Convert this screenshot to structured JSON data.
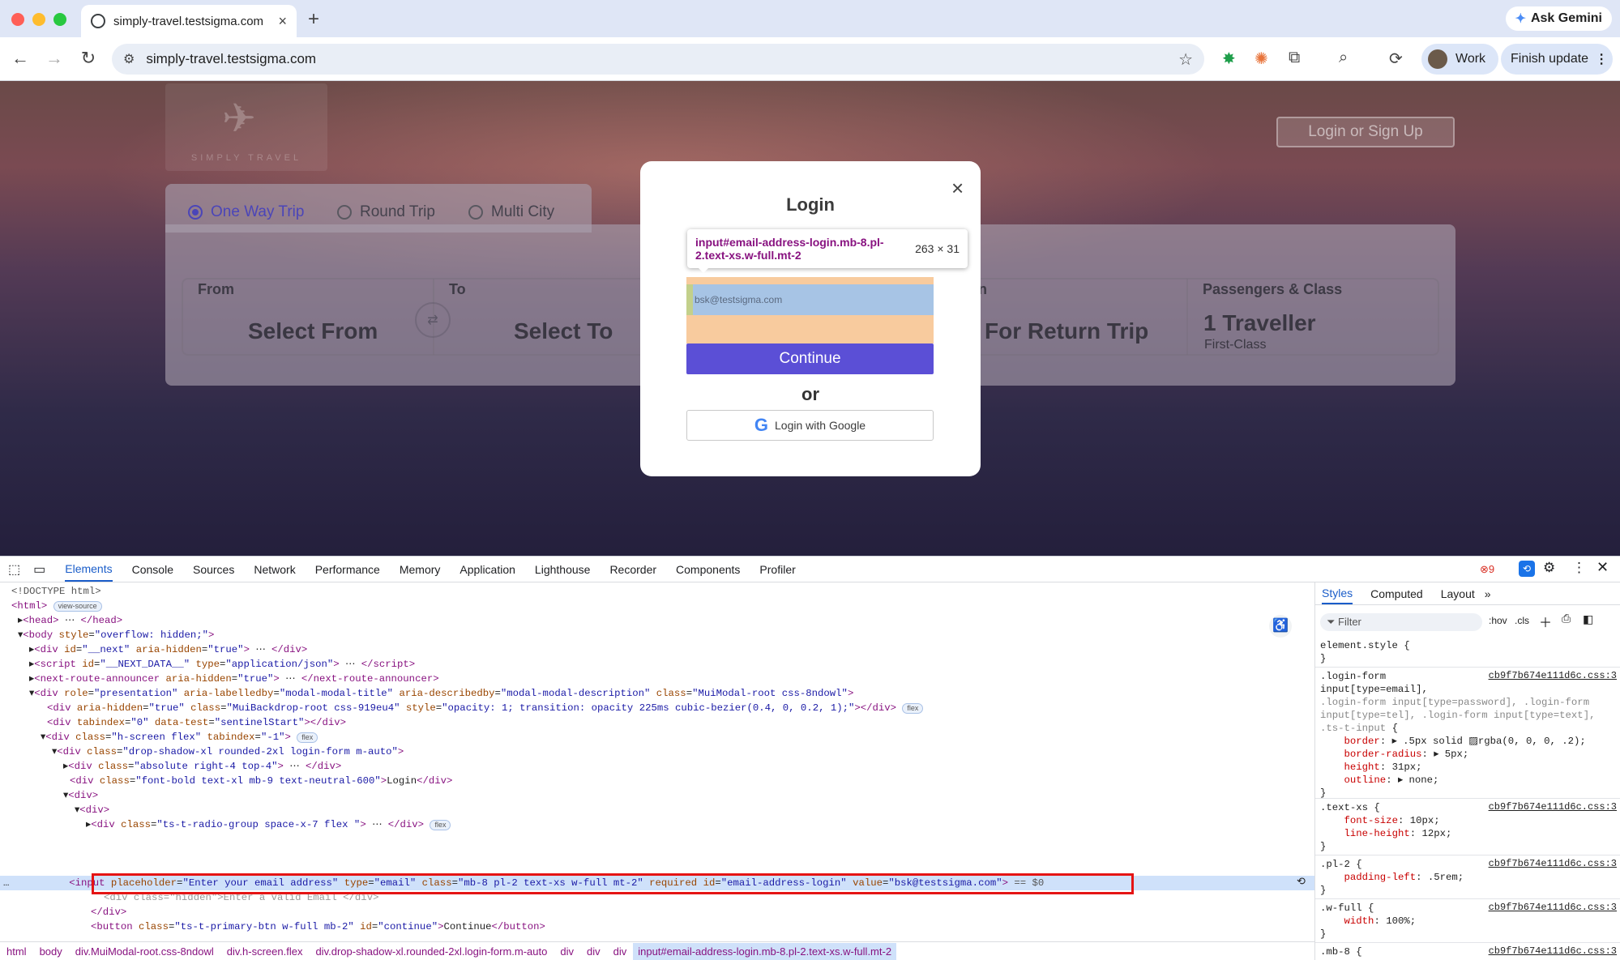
{
  "browser": {
    "tab_title": "simply-travel.testsigma.com",
    "tab_close": "×",
    "new_tab": "+",
    "ask_gemini": "Ask Gemini",
    "url": "simply-travel.testsigma.com",
    "profile": "Work",
    "finish_update": "Finish update"
  },
  "site": {
    "logo_text": "SIMPLY TRAVEL",
    "login_signup": "Login or Sign Up",
    "trip_types": [
      "One Way Trip",
      "Round Trip",
      "Multi City"
    ],
    "selected_trip": "One Way Trip",
    "labels": {
      "from": "From",
      "to": "To",
      "return": "rn",
      "passengers": "Passengers & Class"
    },
    "values": {
      "from": "Select From",
      "to": "Select To",
      "return": "For Return Trip",
      "travellers": "1 Traveller",
      "class": "First-Class"
    }
  },
  "modal": {
    "title": "Login",
    "close": "×",
    "tooltip_selector": "input#email-address-login.mb-8.pl-2.text-xs.w-full.mt-2",
    "tooltip_dims": "263 × 31",
    "email_value": "bsk@testsigma.com",
    "continue": "Continue",
    "or": "or",
    "google": "Login with Google"
  },
  "devtools": {
    "tabs": [
      "Elements",
      "Console",
      "Sources",
      "Network",
      "Performance",
      "Memory",
      "Application",
      "Lighthouse",
      "Recorder",
      "Components",
      "Profiler"
    ],
    "error_count": "9",
    "breadcrumbs": [
      "html",
      "body",
      "div.MuiModal-root.css-8ndowl",
      "div.h-screen.flex",
      "div.drop-shadow-xl.rounded-2xl.login-form.m-auto",
      "div",
      "div",
      "div",
      "input#email-address-login.mb-8.pl-2.text-xs.w-full.mt-2"
    ],
    "styles_tabs": [
      "Styles",
      "Computed",
      "Layout"
    ],
    "filter_placeholder": "Filter",
    "hov": ":hov",
    "cls": ".cls",
    "css_file": "cb9f7b674e111d6c.css:3"
  },
  "colors": {
    "accent": "#5b4fd6",
    "devtools_blue": "#1a5dc9",
    "highlight_box": "#e51414"
  }
}
